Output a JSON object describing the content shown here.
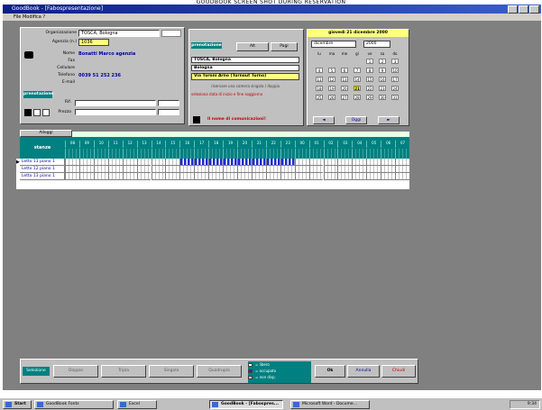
{
  "caption": "GOODBOOK SCREEN SHOT DURING RESERVATION",
  "window": {
    "title": "GoodBook - [Fabospresentazione]",
    "menu": "File  Modifica  ?"
  },
  "agency": {
    "label_agency": "Organizzazione",
    "agency_value": "TOSCA, Bologna",
    "label_code": "Agenzia (n.)",
    "code_value": "1036",
    "label_name": "Nome",
    "name_value": "Bonatti Marco agenzia",
    "label_tel": "Telefono",
    "tel_value": "0039 51 252 236",
    "label_fax": "Fax",
    "label_mobile": "Cellulare",
    "label_email": "E-mail",
    "reservation_button": "prenotazione",
    "label_ref": "Rif.",
    "label_price": "Prezzo"
  },
  "location": {
    "tab_label": "prenotazione",
    "toggle_1": "Alt",
    "toggle_2": "Pagi",
    "city_value": "TOSCA, Bologna",
    "district_value": "Bologna",
    "address_value": "Via Turoni Arno (Turnout Turno)",
    "hint_1": "riservare una camera singola / doppia",
    "hint_2": "seleziona data di inizio e fine soggiorno",
    "notice": "Il nome di comunicazioni!"
  },
  "calendar": {
    "header": "giovedì 21 dicembre 2000",
    "month": "dicembre",
    "year": "2000",
    "weekdays": [
      "lu",
      "ma",
      "me",
      "gi",
      "ve",
      "sa",
      "do"
    ],
    "days": [
      "",
      "",
      "",
      "",
      "1",
      "2",
      "3",
      "4",
      "5",
      "6",
      "7",
      "8",
      "9",
      "10",
      "11",
      "12",
      "13",
      "14",
      "15",
      "16",
      "17",
      "18",
      "19",
      "20",
      "21",
      "22",
      "23",
      "24",
      "25",
      "26",
      "27",
      "28",
      "29",
      "30",
      "31"
    ],
    "selected_day": "21",
    "today_button": "Oggi",
    "prev_button": "◄",
    "next_button": "►"
  },
  "grid": {
    "filter_label": "Alloggi",
    "column_label": "stanze",
    "hours": [
      "08",
      "09",
      "10",
      "11",
      "12",
      "13",
      "14",
      "15",
      "16",
      "17",
      "18",
      "19",
      "20",
      "21",
      "22",
      "23",
      "00",
      "01",
      "02",
      "03",
      "04",
      "05",
      "06",
      "07"
    ],
    "rows": [
      "Letto 11 piano 1",
      "Letto 12 piano 1",
      "Letto 13 piano 1"
    ],
    "booking_row": 0,
    "booking_start": 8,
    "booking_end": 16
  },
  "footer": {
    "section_label": "Selezione",
    "buttons": [
      "Doppio",
      "Tripla",
      "Singola",
      "Quadrupla"
    ],
    "legend": [
      "= libero",
      "= occupato",
      "= non disp."
    ],
    "ok_button": "Ok",
    "cancel_button": "Annulla",
    "close_button": "Chiudi"
  },
  "taskbar": {
    "start": "Start",
    "items": [
      "GoodBook Fonts",
      "Excel",
      "GoodBook - [Fabospres...",
      "Microsoft Word - Docume..."
    ],
    "clock": "9:34"
  }
}
